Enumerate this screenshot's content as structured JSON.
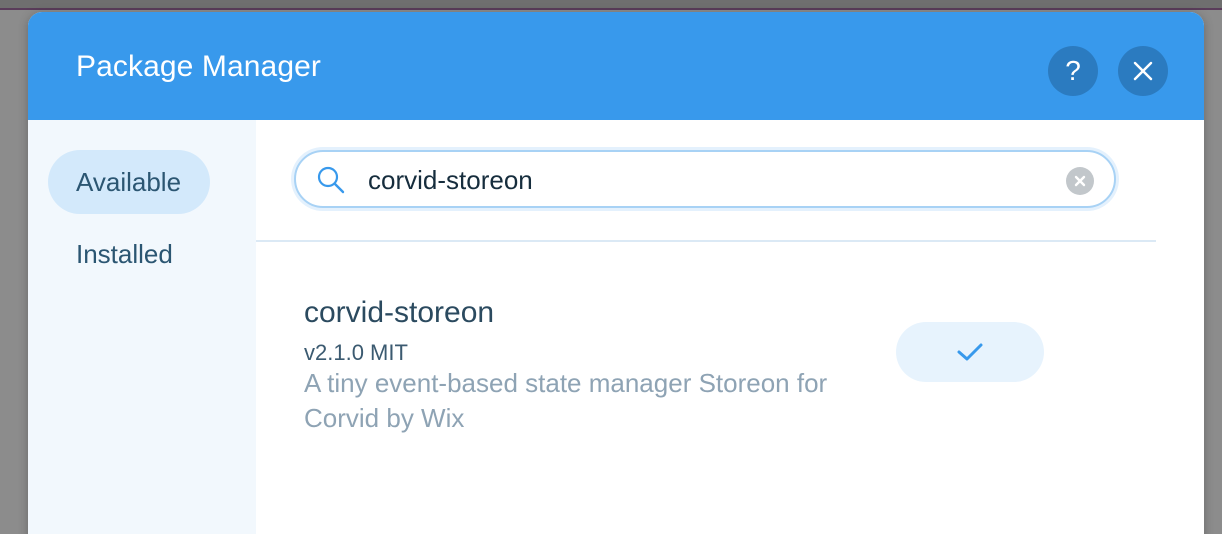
{
  "dialog": {
    "title": "Package Manager",
    "help_label": "?",
    "accent_color": "#3899ec"
  },
  "sidebar": {
    "items": [
      {
        "label": "Available",
        "selected": true
      },
      {
        "label": "Installed",
        "selected": false
      }
    ]
  },
  "search": {
    "value": "corvid-storeon",
    "icon": "search-icon",
    "clear_icon": "clear-icon"
  },
  "results": [
    {
      "name": "corvid-storeon",
      "meta": "v2.1.0 MIT",
      "description": "A tiny event-based state manager Storeon for Corvid by Wix",
      "status_icon": "checkmark-icon"
    }
  ]
}
